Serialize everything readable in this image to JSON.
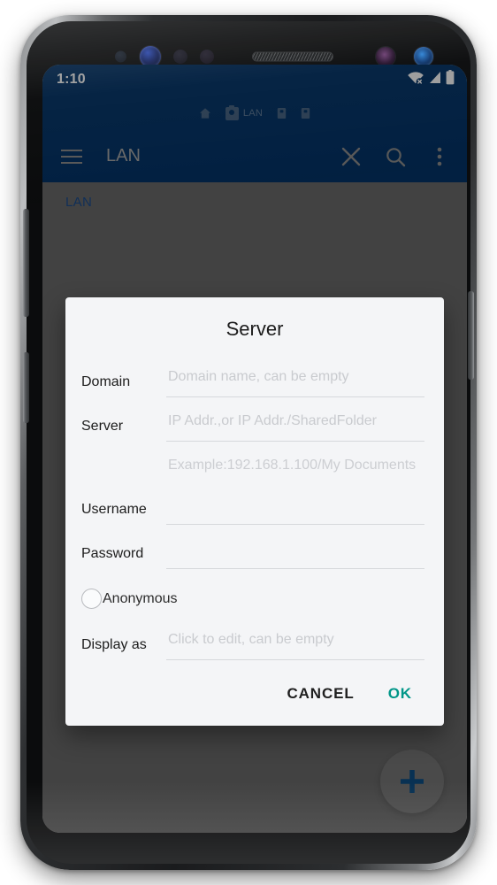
{
  "device": {
    "name": "android-phone-mockup",
    "frame_color": "#1a1b1d"
  },
  "status_bar": {
    "time": "1:10",
    "icons": [
      {
        "name": "wifi-off-icon",
        "label": "wifi-disconnected"
      },
      {
        "name": "signal-icon",
        "label": "cellular-signal"
      },
      {
        "name": "battery-icon",
        "label": "battery-full"
      }
    ]
  },
  "appbar": {
    "background": "#043569",
    "menu_icon": "hamburger-menu-icon",
    "title": "LAN",
    "title_color": "#a9a9a9",
    "actions": [
      {
        "name": "close-icon",
        "label": "Close"
      },
      {
        "name": "search-icon",
        "label": "Search"
      },
      {
        "name": "overflow-menu-icon",
        "label": "More options"
      }
    ],
    "breadcrumb_strip": [
      {
        "name": "home-icon",
        "label": ""
      },
      {
        "name": "folder-lan-chip",
        "label": "LAN",
        "active": true
      },
      {
        "name": "folder-icon-2",
        "label": ""
      },
      {
        "name": "folder-icon-3",
        "label": ""
      }
    ]
  },
  "content": {
    "path_label": "LAN",
    "path_color": "#1b4d8f",
    "fab": {
      "name": "add-button",
      "glyph": "+",
      "color": "#0d4f86"
    }
  },
  "dialog": {
    "title": "Server",
    "background": "#f4f5f7",
    "fields": [
      {
        "key": "domain",
        "label": "Domain",
        "value": "",
        "placeholder": "Domain name, can be empty"
      },
      {
        "key": "server",
        "label": "Server",
        "value": "",
        "placeholder": "IP Addr.,or IP Addr./SharedFolder",
        "helper": "Example:192.168.1.100/My Documents"
      },
      {
        "key": "username",
        "label": "Username",
        "value": "",
        "placeholder": ""
      },
      {
        "key": "password",
        "label": "Password",
        "value": "",
        "placeholder": ""
      },
      {
        "key": "display_as",
        "label": "Display as",
        "value": "",
        "placeholder": "Click to edit, can be empty"
      }
    ],
    "anonymous": {
      "label": "Anonymous",
      "checked": false
    },
    "buttons": {
      "cancel": "CANCEL",
      "ok": "OK",
      "ok_color": "#009688"
    }
  }
}
